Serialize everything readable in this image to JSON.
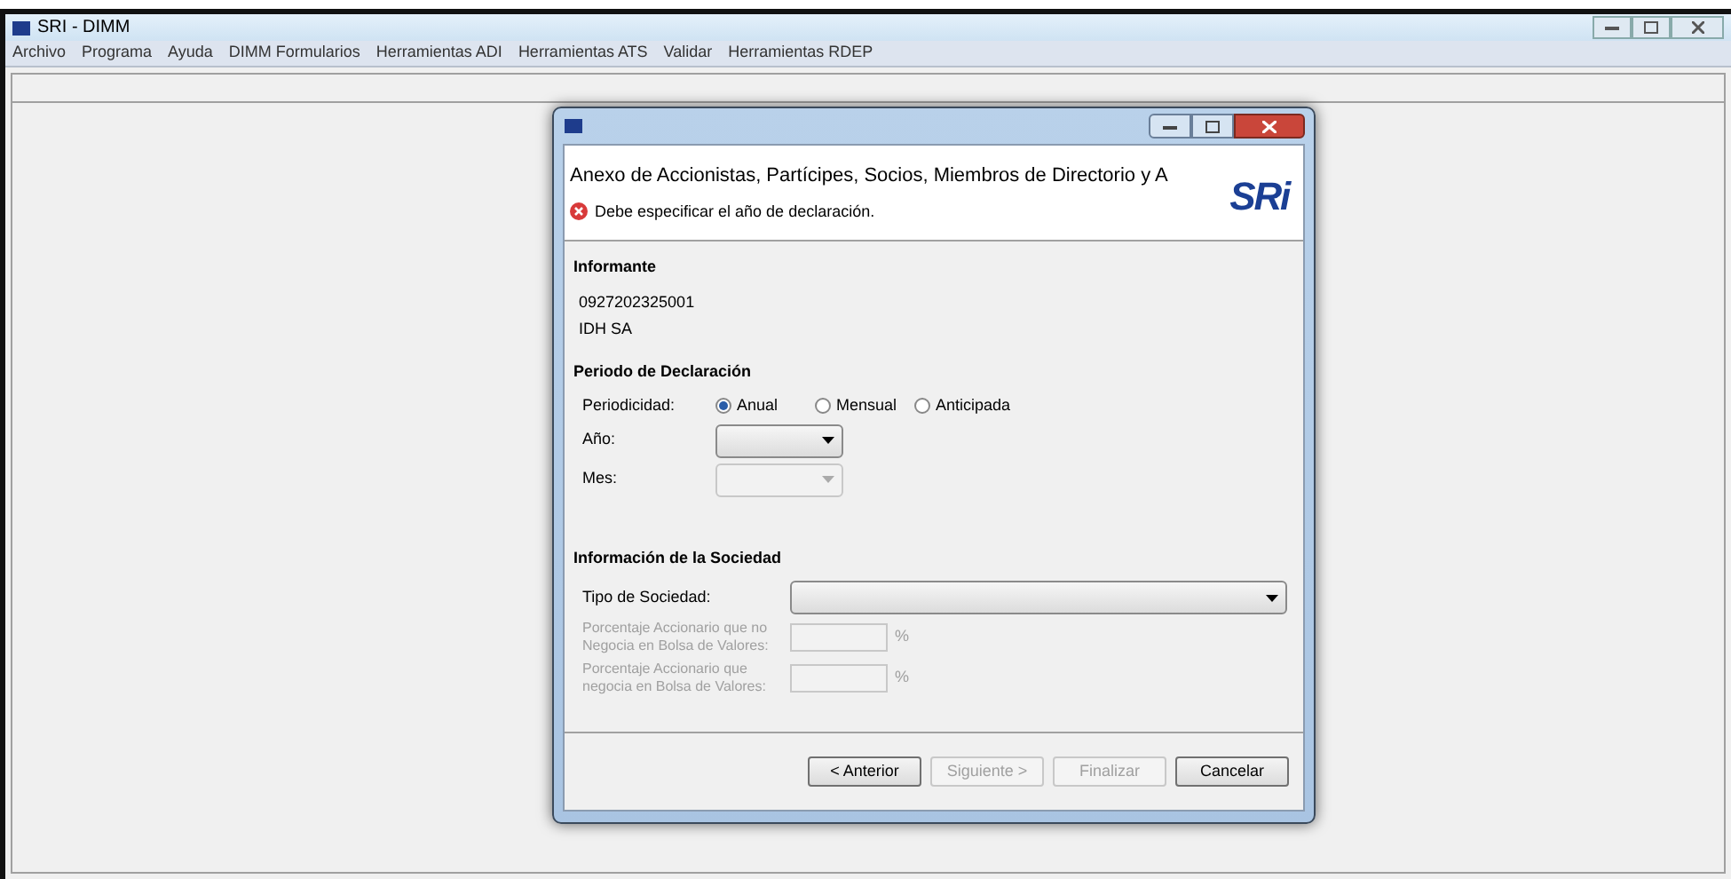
{
  "window": {
    "title": "SRI - DIMM"
  },
  "menu": [
    "Archivo",
    "Programa",
    "Ayuda",
    "DIMM Formularios",
    "Herramientas ADI",
    "Herramientas ATS",
    "Validar",
    "Herramientas RDEP"
  ],
  "dialog": {
    "title": "Anexo de Accionistas, Partícipes, Socios, Miembros de Directorio y A",
    "error": "Debe especificar el año de declaración.",
    "logo": "SRi",
    "informante": {
      "heading": "Informante",
      "ruc": "0927202325001",
      "name": "IDH SA"
    },
    "periodo": {
      "heading": "Periodo de Declaración",
      "periodicidad_label": "Periodicidad:",
      "options": [
        {
          "label": "Anual",
          "selected": true
        },
        {
          "label": "Mensual",
          "selected": false
        },
        {
          "label": "Anticipada",
          "selected": false
        }
      ],
      "fields": [
        {
          "label": "Año:",
          "disabled": false
        },
        {
          "label": "Mes:",
          "disabled": true
        }
      ]
    },
    "sociedad": {
      "heading": "Información de la Sociedad",
      "tipo_label": "Tipo de Sociedad:",
      "percent_fields": [
        {
          "label": "Porcentaje Accionario que no Negocia en Bolsa de Valores:",
          "unit": "%",
          "disabled": true
        },
        {
          "label": "Porcentaje Accionario que negocia en Bolsa de Valores:",
          "unit": "%",
          "disabled": true
        }
      ]
    },
    "buttons": [
      {
        "label": "< Anterior",
        "disabled": false
      },
      {
        "label": "Siguiente >",
        "disabled": true
      },
      {
        "label": "Finalizar",
        "disabled": true
      },
      {
        "label": "Cancelar",
        "disabled": false
      }
    ]
  }
}
